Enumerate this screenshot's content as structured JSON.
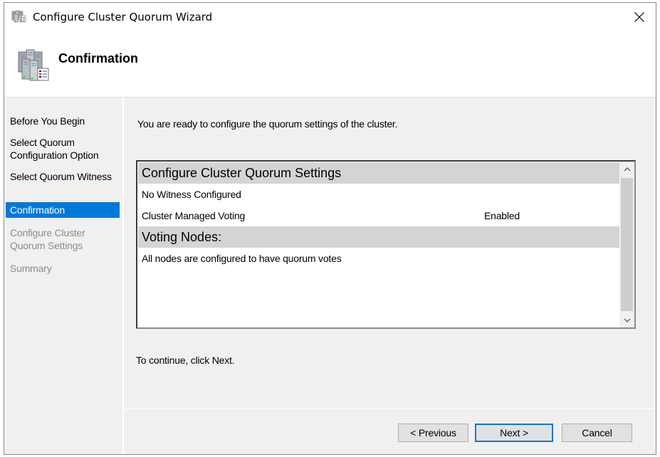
{
  "window": {
    "title": "Configure Cluster Quorum Wizard",
    "icons": {
      "app": "cluster-wizard-icon",
      "close": "close-icon",
      "header": "cluster-servers-icon"
    }
  },
  "header": {
    "title": "Confirmation"
  },
  "sidebar": {
    "items": [
      {
        "label": "Before You Begin",
        "state": "completed"
      },
      {
        "label": "Select Quorum Configuration Option",
        "state": "completed"
      },
      {
        "label": "Select Quorum Witness",
        "state": "completed"
      },
      {
        "label": "Confirmation",
        "state": "active"
      },
      {
        "label": "Configure Cluster Quorum Settings",
        "state": "disabled"
      },
      {
        "label": "Summary",
        "state": "disabled"
      }
    ],
    "active_color": "#0078d7"
  },
  "main": {
    "intro": "You are ready to configure the quorum settings of the cluster.",
    "report": {
      "sections": [
        {
          "heading": "Configure Cluster Quorum Settings",
          "rows": [
            {
              "label": "No Witness Configured",
              "value": ""
            },
            {
              "label": "Cluster Managed Voting",
              "value": "Enabled"
            }
          ]
        },
        {
          "heading": "Voting Nodes:",
          "rows": [
            {
              "label": "All nodes are configured to have quorum votes",
              "value": ""
            }
          ]
        }
      ],
      "scrollbar": {
        "up_icon": "chevron-up-icon",
        "down_icon": "chevron-down-icon"
      }
    },
    "continue_text": "To continue, click Next."
  },
  "buttons": {
    "previous": "< Previous",
    "next": "Next >",
    "cancel": "Cancel"
  }
}
